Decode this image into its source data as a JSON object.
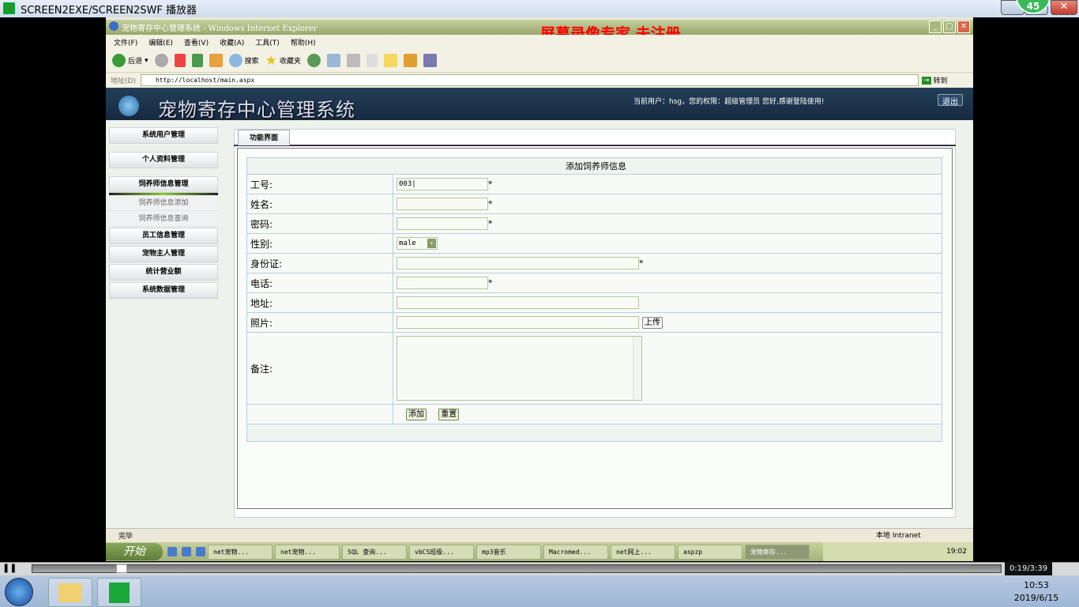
{
  "player": {
    "title": "SCREEN2EXE/SCREEN2SWF 播放器",
    "badge": "45",
    "time": "0:19/3:39",
    "progress": 0.087
  },
  "ie": {
    "title": "宠物寄存中心管理系统 - Windows Internet Explorer",
    "watermark": "屏幕录像专家  未注册",
    "menu": [
      "文件(F)",
      "编辑(E)",
      "查看(V)",
      "收藏(A)",
      "工具(T)",
      "帮助(H)"
    ],
    "toolbar": {
      "back": "后退",
      "search": "搜索",
      "favorites": "收藏夹"
    },
    "address_label": "地址(D)",
    "address": "http://localhost/main.aspx",
    "go": "转到",
    "status": "完毕",
    "zone": "本地 Intranet"
  },
  "app": {
    "name": "宠物寄存中心管理系统",
    "userinfo": "当前用户：hsg，您的权限：超级管理员  您好,感谢登陆使用!",
    "logout": "退出",
    "sidebar": [
      {
        "label": "系统用户管理"
      },
      {
        "label": "个人资料管理"
      },
      {
        "label": "饲养师信息管理"
      }
    ],
    "submenu": [
      "饲养师信息添加",
      "饲养师信息查询"
    ],
    "sidebar2": [
      "员工信息管理",
      "宠物主人管理",
      "统计营业额",
      "系统数据管理"
    ],
    "tab": "功能界面",
    "form": {
      "title": "添加饲养师信息",
      "id_label": "工号:",
      "id_value": "003",
      "name_label": "姓名:",
      "pwd_label": "密码:",
      "gender_label": "性别:",
      "gender_value": "male",
      "idcard_label": "身份证:",
      "phone_label": "电话:",
      "addr_label": "地址:",
      "photo_label": "照片:",
      "upload": "上传",
      "remark_label": "备注:",
      "add": "添加",
      "reset": "重置",
      "required": "*"
    }
  },
  "xp_taskbar": {
    "start": "开始",
    "tasks": [
      "net宠物...",
      "net宠物...",
      "SQL 查询...",
      "vbCS班级...",
      "mp3音乐",
      "Macromed...",
      "net网上...",
      "aspzp",
      "宠物寄存..."
    ],
    "clock": "19:02"
  },
  "w7": {
    "time": "10:53",
    "date": "2019/6/15"
  }
}
